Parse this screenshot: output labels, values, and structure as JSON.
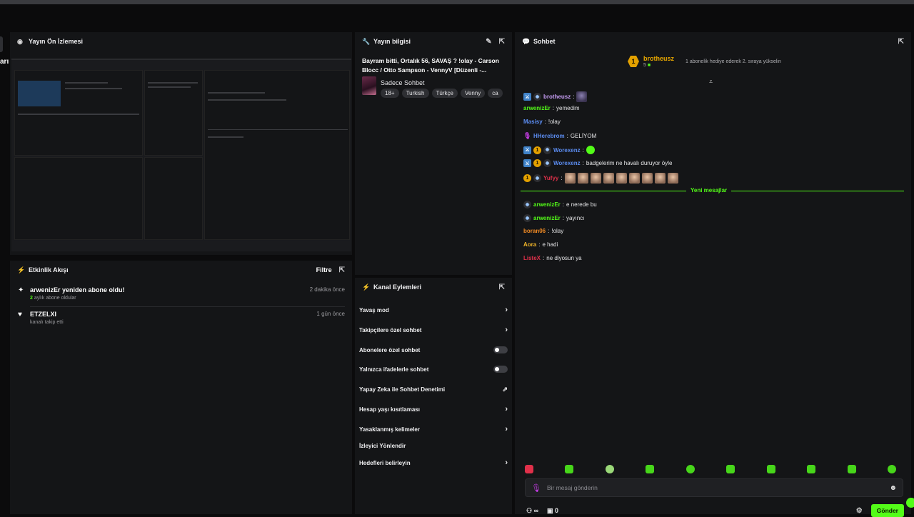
{
  "left_cut_label": "arı",
  "preview": {
    "title": "Yayın Ön İzlemesi"
  },
  "activity": {
    "title": "Etkinlik Akışı",
    "filter_label": "Filtre",
    "items": [
      {
        "icon": "sparkle-icon",
        "title": "arwenizEr yeniden abone oldu!",
        "sub_count": "2",
        "sub_text": "aylık abone oldular",
        "time": "2 dakika önce"
      },
      {
        "icon": "heart-icon",
        "title": "ETZELXI",
        "sub_count": "",
        "sub_text": "kanalı takip etti",
        "time": "1 gün önce"
      }
    ]
  },
  "stream_info": {
    "title": "Yayın bilgisi",
    "stream_title": "Bayram bitti, Ortalık 56, SAVAŞ ? !olay - Carson Blocc / Otto Sampson - VennyV [Düzenli -...",
    "category": "Sadece Sohbet",
    "tags": [
      "18+",
      "Turkish",
      "Türkçe",
      "Venny",
      "ca"
    ]
  },
  "channel_actions": {
    "title": "Kanal Eylemleri",
    "items": [
      {
        "label": "Yavaş mod",
        "control": "chevron"
      },
      {
        "label": "Takipçilere özel sohbet",
        "control": "chevron"
      },
      {
        "label": "Abonelere özel sohbet",
        "control": "toggle"
      },
      {
        "label": "Yalnızca ifadelerle sohbet",
        "control": "toggle"
      },
      {
        "label": "Yapay Zeka ile Sohbet Denetimi",
        "control": "external"
      },
      {
        "label": "Hesap yaşı kısıtlaması",
        "control": "chevron"
      },
      {
        "label": "Yasaklanmış kelimeler",
        "control": "chevron"
      },
      {
        "label": "İzleyici Yönlendir",
        "control": "none"
      },
      {
        "label": "Hedefleri belirleyin",
        "control": "chevron"
      }
    ]
  },
  "chat": {
    "title": "Sohbet",
    "pinned": {
      "rank": "1",
      "name": "brotheusz",
      "count": "5",
      "message": "1 abonelik hediye ederek 2. sıraya yükselin"
    },
    "messages": [
      {
        "badges": [
          "mod",
          "og"
        ],
        "name": "brotheusz",
        "color": "#c59cf2",
        "text": "",
        "emotes": 0,
        "avatar": true
      },
      {
        "badges": [],
        "name": "arwenizEr",
        "color": "#53fc18",
        "text": "yemedim",
        "emotes": 0
      },
      {
        "badges": [],
        "name": "Masisy",
        "color": "#5b8cf0",
        "text": "!olay",
        "emotes": 0
      },
      {
        "badges": [
          "mic"
        ],
        "name": "HHerebrom",
        "color": "#5b8cf0",
        "text": "GELİYOM",
        "emotes": 0
      },
      {
        "badges": [
          "mod",
          "sub",
          "og"
        ],
        "name": "Worexenz",
        "color": "#5b8cf0",
        "text": "",
        "emotes": 0,
        "green": true
      },
      {
        "badges": [
          "mod",
          "sub",
          "og"
        ],
        "name": "Worexenz",
        "color": "#5b8cf0",
        "text": "badgelerim ne havalı duruyor öyle",
        "emotes": 0
      },
      {
        "badges": [
          "sub",
          "og"
        ],
        "name": "Yufyy",
        "color": "#e0304a",
        "text": "",
        "emotes": 9
      }
    ],
    "separator": "Yeni mesajlar",
    "new_messages": [
      {
        "badges": [
          "og"
        ],
        "name": "arwenizEr",
        "color": "#53fc18",
        "text": "e nerede bu"
      },
      {
        "badges": [
          "og"
        ],
        "name": "arwenizEr",
        "color": "#53fc18",
        "text": "yayıncı"
      },
      {
        "badges": [],
        "name": "boran06",
        "color": "#f08a24",
        "text": "!olay"
      },
      {
        "badges": [],
        "name": "Aora",
        "color": "#f0b429",
        "text": "e hadi"
      },
      {
        "badges": [],
        "name": "ListeX",
        "color": "#e0304a",
        "text": "ne diyosun ya"
      }
    ],
    "input_placeholder": "Bir mesaj gönderin",
    "viewer_symbol": "∞",
    "store_count": "0",
    "send_label": "Gönder"
  },
  "colors": {
    "accent": "#53fc18",
    "panel": "#141517",
    "bg": "#0b0b0c"
  }
}
